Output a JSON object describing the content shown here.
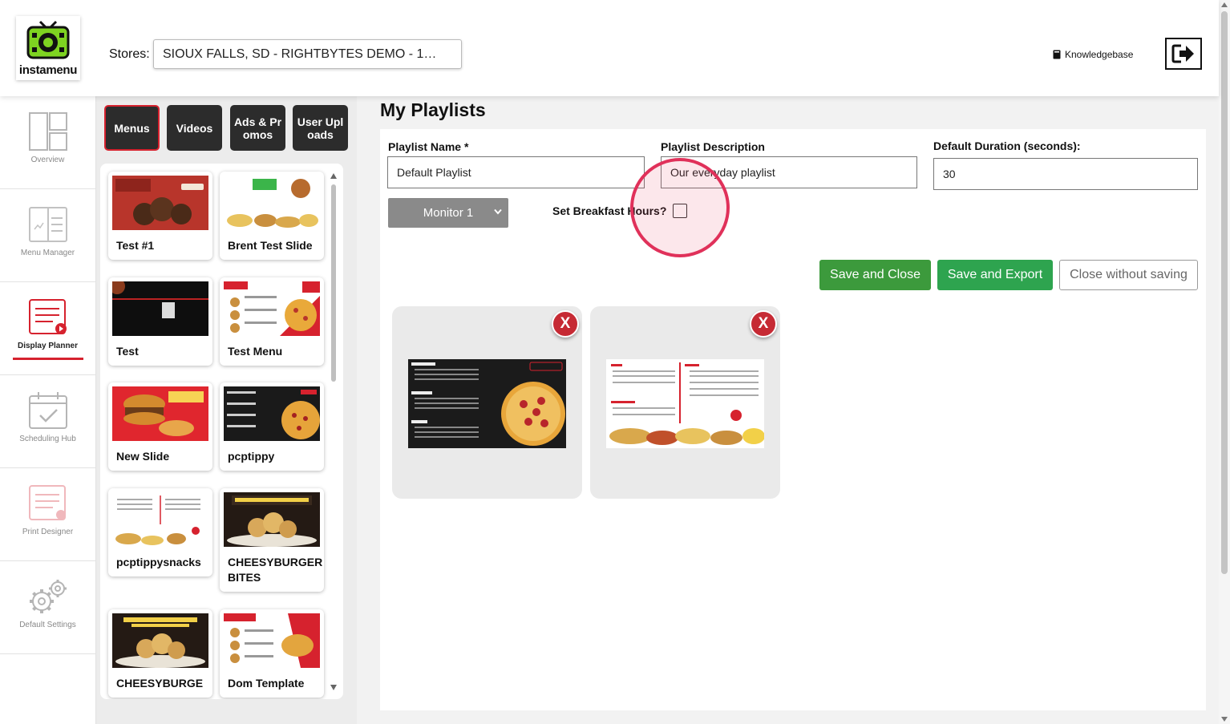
{
  "app": {
    "logo_text": "instamenu"
  },
  "header": {
    "stores_label": "Stores:",
    "store_selected": "SIOUX FALLS, SD - RIGHTBYTES DEMO - 1…",
    "knowledgebase_label": "Knowledgebase"
  },
  "sidebar": {
    "items": [
      {
        "label": "Overview",
        "icon": "layout-icon"
      },
      {
        "label": "Menu Manager",
        "icon": "menu-board-icon"
      },
      {
        "label": "Display Planner",
        "icon": "display-planner-icon",
        "active": true
      },
      {
        "label": "Scheduling Hub",
        "icon": "calendar-check-icon"
      },
      {
        "label": "Print Designer",
        "icon": "print-icon"
      },
      {
        "label": "Default Settings",
        "icon": "gears-icon"
      }
    ]
  },
  "content_tabs": [
    {
      "label": "Menus",
      "active": true
    },
    {
      "label": "Videos"
    },
    {
      "label": "Ads & Promos"
    },
    {
      "label": "User Uploads"
    }
  ],
  "slides": [
    {
      "label": "Test #1"
    },
    {
      "label": "Brent Test Slide"
    },
    {
      "label": "Test"
    },
    {
      "label": "Test Menu"
    },
    {
      "label": "New Slide"
    },
    {
      "label": "pcptippy"
    },
    {
      "label": "pcptippysnacks"
    },
    {
      "label": "CHEESYBURGER BITES"
    },
    {
      "label": "CHEESYBURGE"
    },
    {
      "label": "Dom Template"
    }
  ],
  "main": {
    "title": "My Playlists",
    "playlist_name_label": "Playlist Name *",
    "playlist_name_value": "Default Playlist",
    "playlist_description_label": "Playlist Description",
    "playlist_description_value": "Our everyday playlist",
    "default_duration_label": "Default Duration (seconds):",
    "default_duration_value": "30",
    "monitor_selected": "Monitor 1",
    "breakfast_label": "Set Breakfast Hours?",
    "buttons": {
      "save_close": "Save and Close",
      "save_export": "Save and Export",
      "close_without_saving": "Close without saving"
    },
    "remove_label": "X"
  },
  "colors": {
    "accent_red": "#d6222e",
    "save_green": "#3c9a3c",
    "export_green": "#2ea44f",
    "dark_tab": "#2c2c2c",
    "logo_green": "#7ed321"
  }
}
